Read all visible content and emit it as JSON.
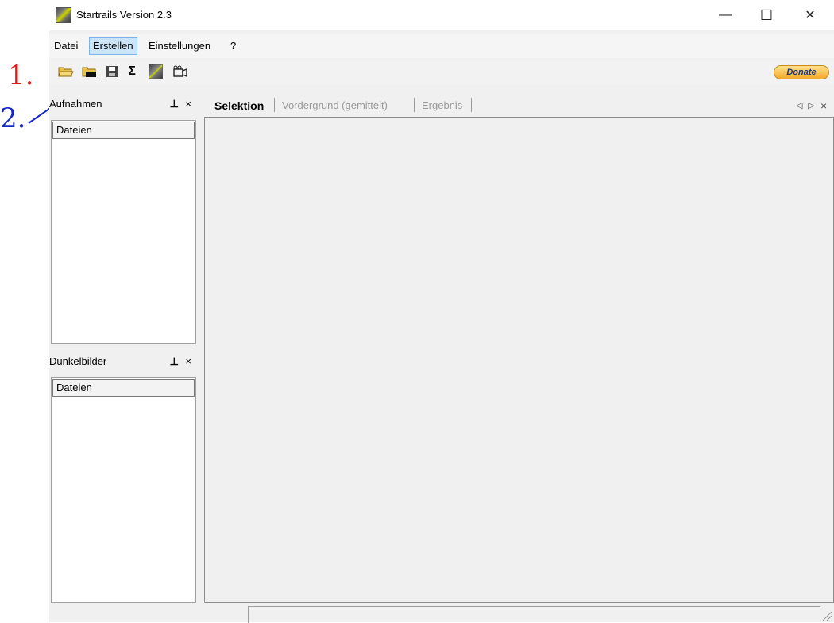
{
  "window": {
    "title": "Startrails Version 2.3",
    "minimize_glyph": "—",
    "maximize_glyph": "☐",
    "close_glyph": "✕"
  },
  "annotations": {
    "mark_1": "1.",
    "mark_2": "2."
  },
  "menu": {
    "items": [
      {
        "label": "Datei"
      },
      {
        "label": "Erstellen"
      },
      {
        "label": "Einstellungen"
      },
      {
        "label": "?"
      }
    ],
    "active_index": 1
  },
  "toolbar": {
    "buttons": [
      {
        "icon": "open-folder-icon"
      },
      {
        "icon": "open-darkframe-folder-icon"
      },
      {
        "icon": "save-icon"
      },
      {
        "icon": "sum-icon",
        "glyph": "Σ"
      },
      {
        "icon": "startrails-icon"
      },
      {
        "icon": "video-icon"
      }
    ],
    "donate_label": "Donate"
  },
  "panels": {
    "aufnahmen": {
      "title": "Aufnahmen",
      "column": "Dateien",
      "pin_glyph": "⊥",
      "close_glyph": "×"
    },
    "dunkelbilder": {
      "title": "Dunkelbilder",
      "column": "Dateien",
      "pin_glyph": "⊥",
      "close_glyph": "×"
    }
  },
  "tabs": {
    "items": [
      {
        "label": "Selektion"
      },
      {
        "label": "Vordergrund (gemittelt)"
      },
      {
        "label": "Ergebnis"
      }
    ],
    "active_index": 0,
    "nav_prev": "◁",
    "nav_next": "▷",
    "nav_close": "×"
  },
  "colors": {
    "annotation_red": "#e01818",
    "annotation_blue": "#1428c8",
    "menu_active_bg": "#cce4f7"
  }
}
